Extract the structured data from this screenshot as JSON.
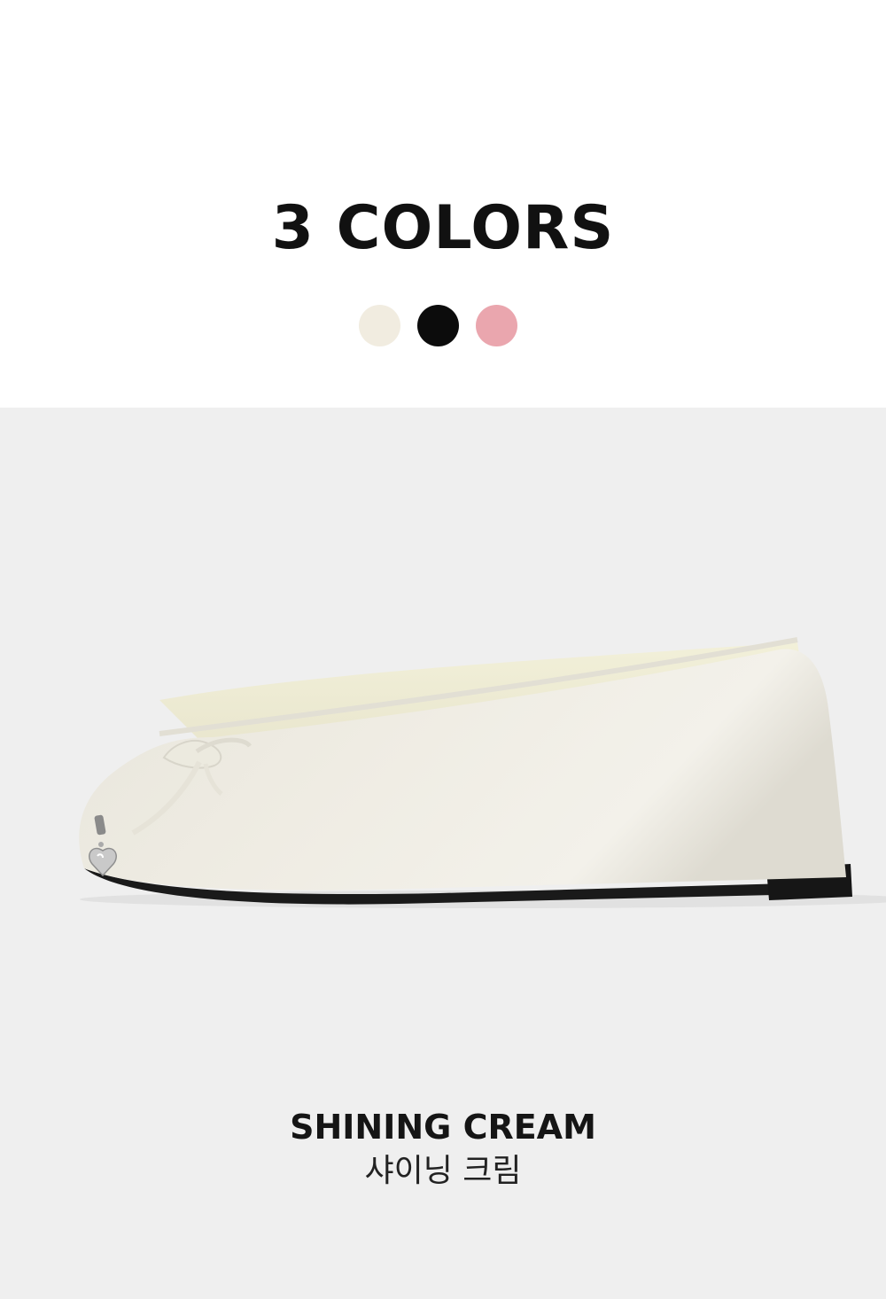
{
  "header": {
    "title": "3 COLORS"
  },
  "colors": {
    "swatches": [
      {
        "name": "cream",
        "hex": "#f1ece0"
      },
      {
        "name": "black",
        "hex": "#0c0c0c"
      },
      {
        "name": "pink",
        "hex": "#eaa6ae"
      }
    ]
  },
  "product": {
    "color_name_en": "SHINING CREAM",
    "color_name_ko": "샤이닝 크림",
    "shoe_color": "#eeebe2",
    "background": "#efefef"
  }
}
